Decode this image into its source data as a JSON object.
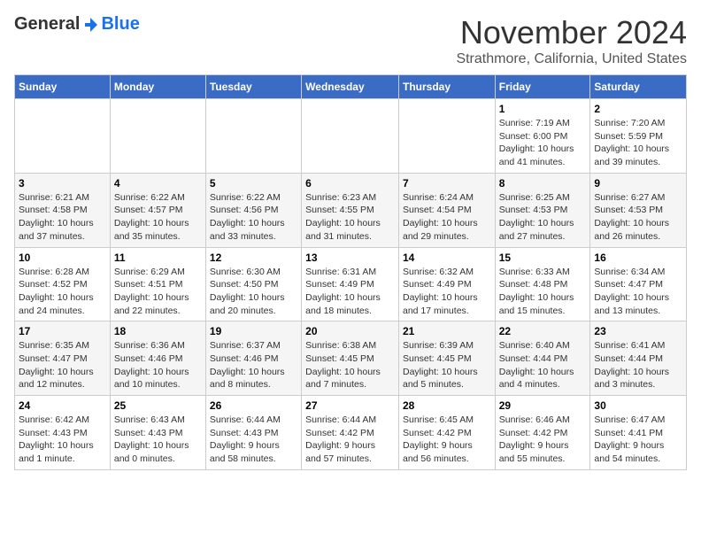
{
  "header": {
    "logo_general": "General",
    "logo_blue": "Blue",
    "month_title": "November 2024",
    "subtitle": "Strathmore, California, United States"
  },
  "weekdays": [
    "Sunday",
    "Monday",
    "Tuesday",
    "Wednesday",
    "Thursday",
    "Friday",
    "Saturday"
  ],
  "weeks": [
    {
      "days": [
        {
          "num": "",
          "info": ""
        },
        {
          "num": "",
          "info": ""
        },
        {
          "num": "",
          "info": ""
        },
        {
          "num": "",
          "info": ""
        },
        {
          "num": "",
          "info": ""
        },
        {
          "num": "1",
          "info": "Sunrise: 7:19 AM\nSunset: 6:00 PM\nDaylight: 10 hours\nand 41 minutes."
        },
        {
          "num": "2",
          "info": "Sunrise: 7:20 AM\nSunset: 5:59 PM\nDaylight: 10 hours\nand 39 minutes."
        }
      ]
    },
    {
      "days": [
        {
          "num": "3",
          "info": "Sunrise: 6:21 AM\nSunset: 4:58 PM\nDaylight: 10 hours\nand 37 minutes."
        },
        {
          "num": "4",
          "info": "Sunrise: 6:22 AM\nSunset: 4:57 PM\nDaylight: 10 hours\nand 35 minutes."
        },
        {
          "num": "5",
          "info": "Sunrise: 6:22 AM\nSunset: 4:56 PM\nDaylight: 10 hours\nand 33 minutes."
        },
        {
          "num": "6",
          "info": "Sunrise: 6:23 AM\nSunset: 4:55 PM\nDaylight: 10 hours\nand 31 minutes."
        },
        {
          "num": "7",
          "info": "Sunrise: 6:24 AM\nSunset: 4:54 PM\nDaylight: 10 hours\nand 29 minutes."
        },
        {
          "num": "8",
          "info": "Sunrise: 6:25 AM\nSunset: 4:53 PM\nDaylight: 10 hours\nand 27 minutes."
        },
        {
          "num": "9",
          "info": "Sunrise: 6:27 AM\nSunset: 4:53 PM\nDaylight: 10 hours\nand 26 minutes."
        }
      ]
    },
    {
      "days": [
        {
          "num": "10",
          "info": "Sunrise: 6:28 AM\nSunset: 4:52 PM\nDaylight: 10 hours\nand 24 minutes."
        },
        {
          "num": "11",
          "info": "Sunrise: 6:29 AM\nSunset: 4:51 PM\nDaylight: 10 hours\nand 22 minutes."
        },
        {
          "num": "12",
          "info": "Sunrise: 6:30 AM\nSunset: 4:50 PM\nDaylight: 10 hours\nand 20 minutes."
        },
        {
          "num": "13",
          "info": "Sunrise: 6:31 AM\nSunset: 4:49 PM\nDaylight: 10 hours\nand 18 minutes."
        },
        {
          "num": "14",
          "info": "Sunrise: 6:32 AM\nSunset: 4:49 PM\nDaylight: 10 hours\nand 17 minutes."
        },
        {
          "num": "15",
          "info": "Sunrise: 6:33 AM\nSunset: 4:48 PM\nDaylight: 10 hours\nand 15 minutes."
        },
        {
          "num": "16",
          "info": "Sunrise: 6:34 AM\nSunset: 4:47 PM\nDaylight: 10 hours\nand 13 minutes."
        }
      ]
    },
    {
      "days": [
        {
          "num": "17",
          "info": "Sunrise: 6:35 AM\nSunset: 4:47 PM\nDaylight: 10 hours\nand 12 minutes."
        },
        {
          "num": "18",
          "info": "Sunrise: 6:36 AM\nSunset: 4:46 PM\nDaylight: 10 hours\nand 10 minutes."
        },
        {
          "num": "19",
          "info": "Sunrise: 6:37 AM\nSunset: 4:46 PM\nDaylight: 10 hours\nand 8 minutes."
        },
        {
          "num": "20",
          "info": "Sunrise: 6:38 AM\nSunset: 4:45 PM\nDaylight: 10 hours\nand 7 minutes."
        },
        {
          "num": "21",
          "info": "Sunrise: 6:39 AM\nSunset: 4:45 PM\nDaylight: 10 hours\nand 5 minutes."
        },
        {
          "num": "22",
          "info": "Sunrise: 6:40 AM\nSunset: 4:44 PM\nDaylight: 10 hours\nand 4 minutes."
        },
        {
          "num": "23",
          "info": "Sunrise: 6:41 AM\nSunset: 4:44 PM\nDaylight: 10 hours\nand 3 minutes."
        }
      ]
    },
    {
      "days": [
        {
          "num": "24",
          "info": "Sunrise: 6:42 AM\nSunset: 4:43 PM\nDaylight: 10 hours\nand 1 minute."
        },
        {
          "num": "25",
          "info": "Sunrise: 6:43 AM\nSunset: 4:43 PM\nDaylight: 10 hours\nand 0 minutes."
        },
        {
          "num": "26",
          "info": "Sunrise: 6:44 AM\nSunset: 4:43 PM\nDaylight: 9 hours\nand 58 minutes."
        },
        {
          "num": "27",
          "info": "Sunrise: 6:44 AM\nSunset: 4:42 PM\nDaylight: 9 hours\nand 57 minutes."
        },
        {
          "num": "28",
          "info": "Sunrise: 6:45 AM\nSunset: 4:42 PM\nDaylight: 9 hours\nand 56 minutes."
        },
        {
          "num": "29",
          "info": "Sunrise: 6:46 AM\nSunset: 4:42 PM\nDaylight: 9 hours\nand 55 minutes."
        },
        {
          "num": "30",
          "info": "Sunrise: 6:47 AM\nSunset: 4:41 PM\nDaylight: 9 hours\nand 54 minutes."
        }
      ]
    }
  ]
}
